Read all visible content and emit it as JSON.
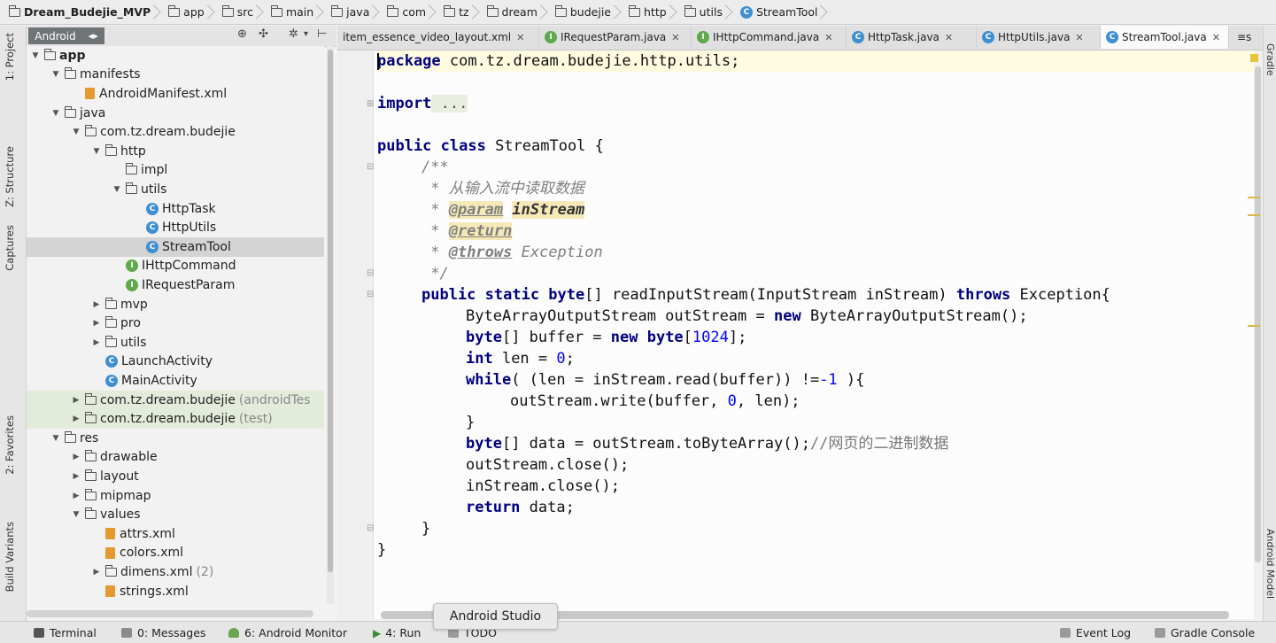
{
  "breadcrumbs": [
    "Dream_Budejie_MVP",
    "app",
    "src",
    "main",
    "java",
    "com",
    "tz",
    "dream",
    "budejie",
    "http",
    "utils",
    "StreamTool"
  ],
  "left_strip": {
    "project": "1: Project",
    "structure": "Z: Structure",
    "captures": "Captures",
    "favorites": "2: Favorites",
    "build_variants": "Build Variants"
  },
  "right_strip": {
    "gradle": "Gradle",
    "android_model": "Android Model"
  },
  "project_view": {
    "selector": "Android"
  },
  "tree": [
    {
      "label": "app",
      "indent": 0,
      "arrow": "▼",
      "icon": "folder",
      "bold": true
    },
    {
      "label": "manifests",
      "indent": 1,
      "arrow": "▼",
      "icon": "folder"
    },
    {
      "label": "AndroidManifest.xml",
      "indent": 2,
      "arrow": "",
      "icon": "xml"
    },
    {
      "label": "java",
      "indent": 1,
      "arrow": "▼",
      "icon": "folder"
    },
    {
      "label": "com.tz.dream.budejie",
      "indent": 2,
      "arrow": "▼",
      "icon": "pkg"
    },
    {
      "label": "http",
      "indent": 3,
      "arrow": "▼",
      "icon": "pkg"
    },
    {
      "label": "impl",
      "indent": 4,
      "arrow": "",
      "icon": "pkg"
    },
    {
      "label": "utils",
      "indent": 4,
      "arrow": "▼",
      "icon": "pkg"
    },
    {
      "label": "HttpTask",
      "indent": 5,
      "arrow": "",
      "icon": "class"
    },
    {
      "label": "HttpUtils",
      "indent": 5,
      "arrow": "",
      "icon": "class"
    },
    {
      "label": "StreamTool",
      "indent": 5,
      "arrow": "",
      "icon": "class",
      "selected": true
    },
    {
      "label": "IHttpCommand",
      "indent": 4,
      "arrow": "",
      "icon": "iface"
    },
    {
      "label": "IRequestParam",
      "indent": 4,
      "arrow": "",
      "icon": "iface"
    },
    {
      "label": "mvp",
      "indent": 3,
      "arrow": "▶",
      "icon": "pkg"
    },
    {
      "label": "pro",
      "indent": 3,
      "arrow": "▶",
      "icon": "pkg"
    },
    {
      "label": "utils",
      "indent": 3,
      "arrow": "▶",
      "icon": "pkg"
    },
    {
      "label": "LaunchActivity",
      "indent": 3,
      "arrow": "",
      "icon": "class"
    },
    {
      "label": "MainActivity",
      "indent": 3,
      "arrow": "",
      "icon": "class"
    },
    {
      "label": "com.tz.dream.budejie",
      "suffix": "(androidTes",
      "indent": 2,
      "arrow": "▶",
      "icon": "pkg",
      "test": true
    },
    {
      "label": "com.tz.dream.budejie",
      "suffix": "(test)",
      "indent": 2,
      "arrow": "▶",
      "icon": "pkg",
      "test": true
    },
    {
      "label": "res",
      "indent": 1,
      "arrow": "▼",
      "icon": "folder"
    },
    {
      "label": "drawable",
      "indent": 2,
      "arrow": "▶",
      "icon": "folder"
    },
    {
      "label": "layout",
      "indent": 2,
      "arrow": "▶",
      "icon": "folder"
    },
    {
      "label": "mipmap",
      "indent": 2,
      "arrow": "▶",
      "icon": "folder"
    },
    {
      "label": "values",
      "indent": 2,
      "arrow": "▼",
      "icon": "folder"
    },
    {
      "label": "attrs.xml",
      "indent": 3,
      "arrow": "",
      "icon": "xml"
    },
    {
      "label": "colors.xml",
      "indent": 3,
      "arrow": "",
      "icon": "xml"
    },
    {
      "label": "dimens.xml",
      "suffix": "(2)",
      "indent": 3,
      "arrow": "▶",
      "icon": "folder"
    },
    {
      "label": "strings.xml",
      "indent": 3,
      "arrow": "",
      "icon": "xml"
    }
  ],
  "tabs": [
    {
      "label": "item_essence_video_layout.xml",
      "icon": "xml"
    },
    {
      "label": "IRequestParam.java",
      "icon": "iface"
    },
    {
      "label": "IHttpCommand.java",
      "icon": "iface"
    },
    {
      "label": "HttpTask.java",
      "icon": "class"
    },
    {
      "label": "HttpUtils.java",
      "icon": "class"
    },
    {
      "label": "StreamTool.java",
      "icon": "class",
      "active": true
    }
  ],
  "tab_overflow": "≡s",
  "code": {
    "l1_kw": "package",
    "l1_rest": " com.tz.dream.budejie.http.utils;",
    "l2_kw": "import",
    "l2_rest": " ...",
    "l3_kw": "public class",
    "l3_rest": " StreamTool {",
    "l4": "/**",
    "l5": " * 从输入流中读取数据",
    "l6_star": " * ",
    "l6_tag": "@param",
    "l6_sp": " ",
    "l6_name": "inStream",
    "l7_star": " * ",
    "l7_tag": "@return",
    "l8_star": " * ",
    "l8_tag": "@throws",
    "l8_rest": " Exception",
    "l9": " */",
    "l10_kw": "public static byte",
    "l10_a": "[] readInputStream(InputStream inStream) ",
    "l10_kw2": "throws",
    "l10_b": " Exception{",
    "l11_a": "ByteArrayOutputStream outStream = ",
    "l11_kw": "new",
    "l11_b": " ByteArrayOutputStream();",
    "l12_kw": "byte",
    "l12_a": "[] buffer = ",
    "l12_kw2": "new byte",
    "l12_b": "[",
    "l12_num": "1024",
    "l12_c": "];",
    "l13_kw": "int",
    "l13_a": " len = ",
    "l13_num": "0",
    "l13_b": ";",
    "l14_kw": "while",
    "l14_a": "( (len = inStream.read(buffer)) !=",
    "l14_num": "-1",
    "l14_b": " ){",
    "l15_a": "outStream.write(buffer, ",
    "l15_num": "0",
    "l15_b": ", len);",
    "l16": "}",
    "l17_kw": "byte",
    "l17_a": "[] data = outStream.toByteArray();",
    "l17_cm": "//网页的二进制数据",
    "l18": "outStream.close();",
    "l19": "inStream.close();",
    "l20_kw": "return",
    "l20_a": " data;",
    "l21": "}",
    "l22": "}"
  },
  "bottom_tabs": {
    "terminal": "Terminal",
    "messages": "0: Messages",
    "monitor": "6: Android Monitor",
    "run": "4: Run",
    "todo": "TODO",
    "event_log": "Event Log",
    "gradle_console": "Gradle Console"
  },
  "tooltip": "Android Studio"
}
